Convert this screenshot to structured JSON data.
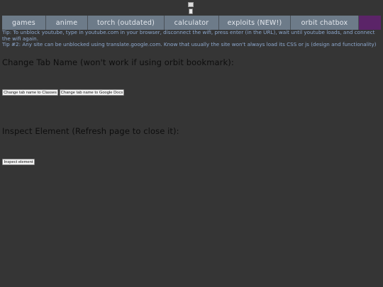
{
  "nav": {
    "items": [
      {
        "label": "games"
      },
      {
        "label": "anime"
      },
      {
        "label": "torch (outdated)"
      },
      {
        "label": "calculator"
      },
      {
        "label": "exploits (NEW!)"
      },
      {
        "label": "orbit chatbox"
      },
      {
        "label": ""
      }
    ],
    "accent_color": "#5b2468",
    "button_color": "#6d7b89"
  },
  "tips": {
    "tip1": "Tip: To unblock youtube, type in youtube.com in your browser, disconnect the wifi, press enter (in the URL), wait until youtube loads, and connect the wifi again.",
    "tip2": "Tip #2: Any site can be unblocked using translate.google.com. Know that usually the site won't always load its CSS or js (design and functionality)"
  },
  "tab_name": {
    "heading": "Change Tab Name (won't work if using orbit bookmark):",
    "classes_button": "Change tab name to Classes",
    "docs_button": "Change tab name to Google Docs"
  },
  "inspect": {
    "heading": "Inspect Element (Refresh page to close it):",
    "button": "Inspect element"
  }
}
